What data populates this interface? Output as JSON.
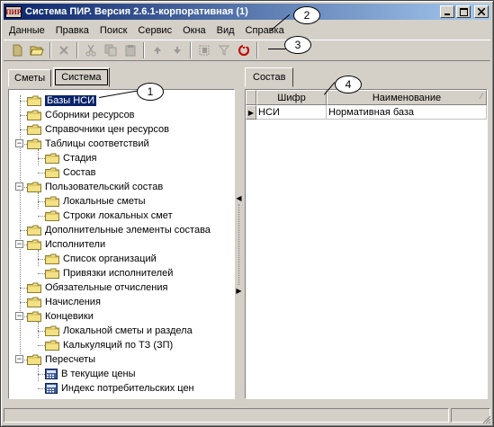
{
  "window": {
    "title": "Система ПИР. Версия 2.6.1-корпоративная (1)",
    "app_icon_text": "ПИР"
  },
  "menu": [
    "Данные",
    "Правка",
    "Поиск",
    "Сервис",
    "Окна",
    "Вид",
    "Справка"
  ],
  "toolbar": {
    "icons": [
      "new-icon",
      "open-icon",
      "delete-icon",
      "cut-icon",
      "copy-icon",
      "paste-icon",
      "move-up-icon",
      "move-down-icon",
      "tree-icon",
      "filter-icon",
      "refresh-icon"
    ]
  },
  "left_tabs": [
    "Сметы",
    "Система"
  ],
  "tree": [
    {
      "label": "Базы НСИ",
      "selected": true
    },
    {
      "label": "Сборники ресурсов"
    },
    {
      "label": "Справочники цен ресурсов"
    },
    {
      "label": "Таблицы соответствий",
      "expanded": true
    },
    {
      "label": "Стадия"
    },
    {
      "label": "Состав"
    },
    {
      "label": "Пользовательский состав",
      "expanded": true
    },
    {
      "label": "Локальные сметы"
    },
    {
      "label": "Строки локальных смет"
    },
    {
      "label": "Дополнительные элементы состава"
    },
    {
      "label": "Исполнители",
      "expanded": true
    },
    {
      "label": "Список организаций"
    },
    {
      "label": "Привязки исполнителей"
    },
    {
      "label": "Обязательные отчисления"
    },
    {
      "label": "Начисления"
    },
    {
      "label": "Концевики",
      "expanded": true
    },
    {
      "label": "Локальной сметы и раздела"
    },
    {
      "label": "Калькуляций по ТЗ (ЗП)"
    },
    {
      "label": "Пересчеты",
      "expanded": true
    },
    {
      "label": "В текущие цены"
    },
    {
      "label": "Индекс потребительских цен"
    }
  ],
  "right_tabs": [
    "Состав"
  ],
  "grid": {
    "columns": [
      "Шифр",
      "Наименование"
    ],
    "rows": [
      {
        "code": "НСИ",
        "name": "Нормативная база"
      }
    ]
  },
  "callouts": [
    "1",
    "2",
    "3",
    "4"
  ]
}
